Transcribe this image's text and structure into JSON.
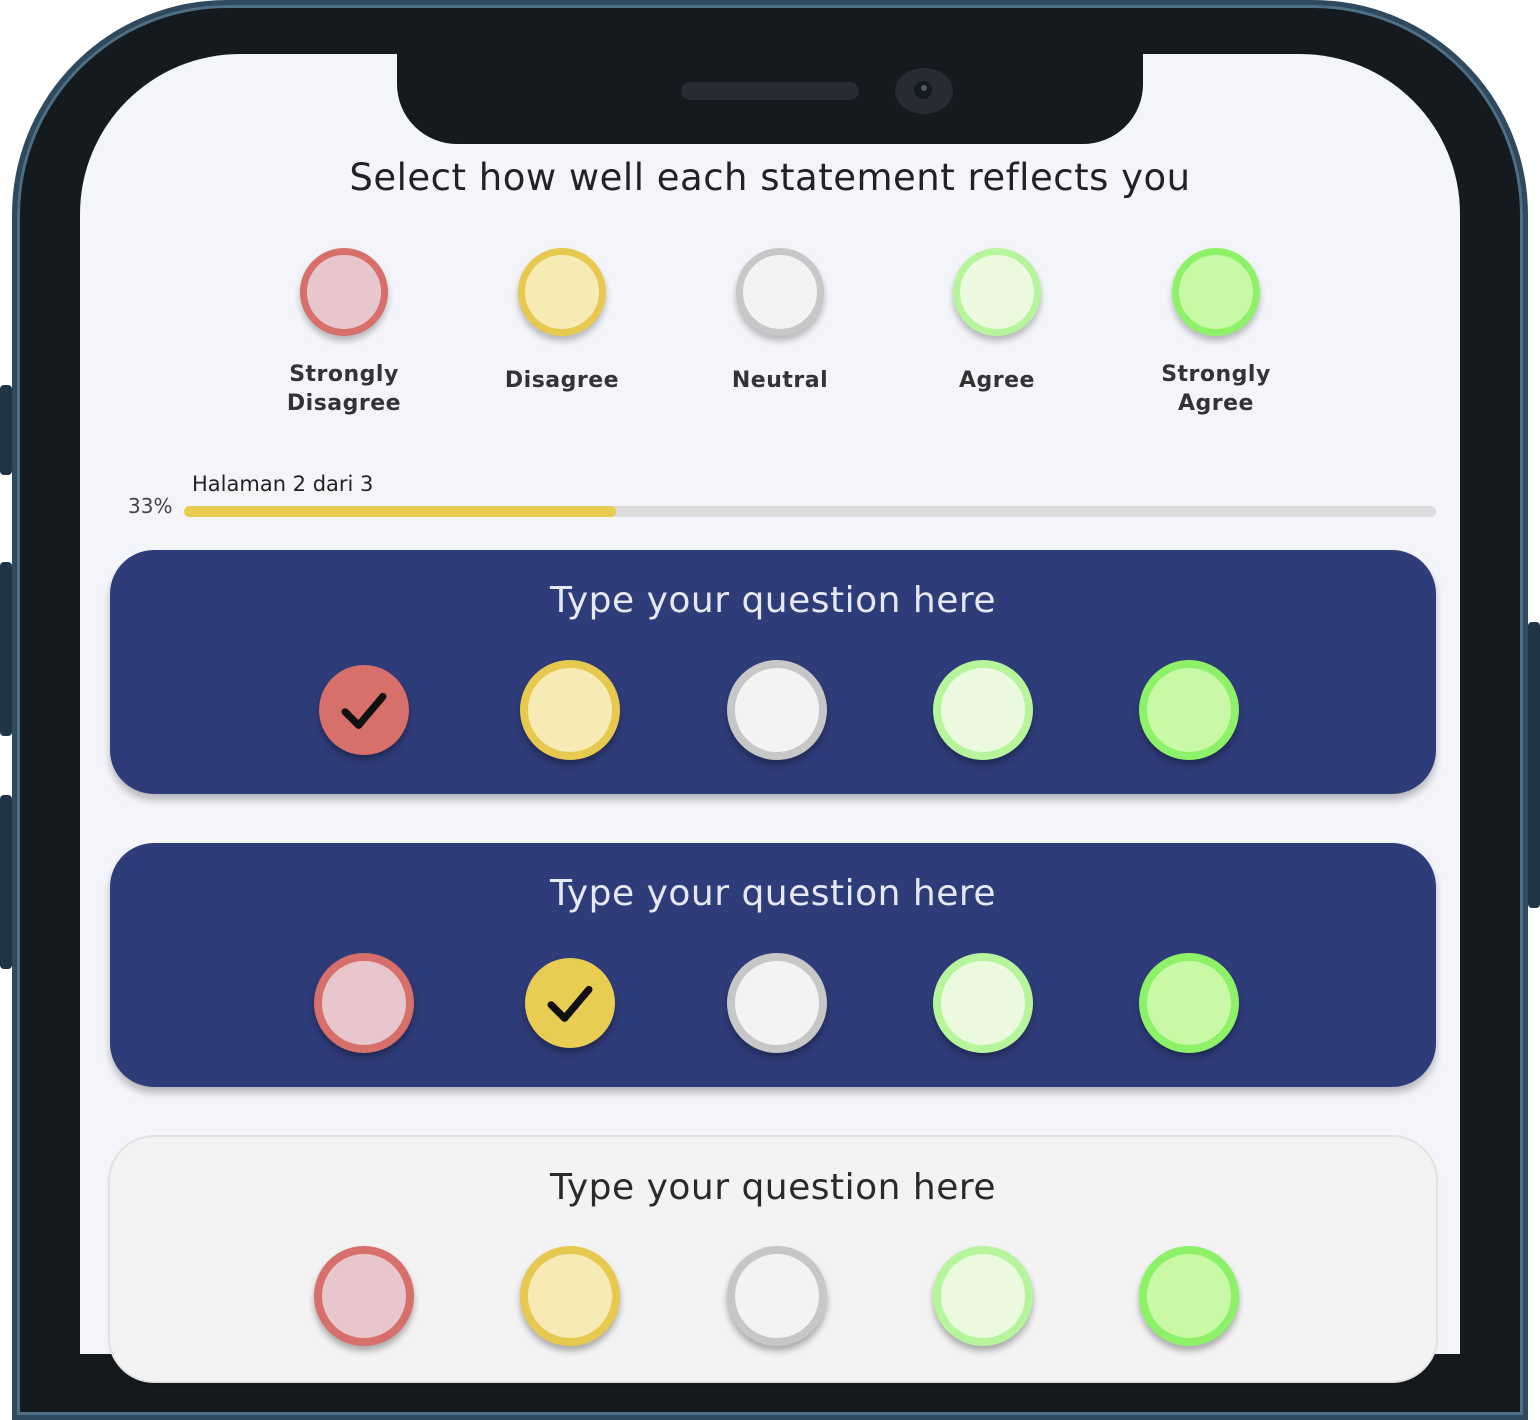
{
  "header": {
    "title": "Select how well each statement reflects you"
  },
  "scale": [
    {
      "label": "Strongly\nDisagree",
      "fill": "#e8c6cd",
      "border": "#d76f6a",
      "selected_fill": "#d76f6a"
    },
    {
      "label": "Disagree",
      "fill": "#f6eab5",
      "border": "#e8c94f",
      "selected_fill": "#e8cd52"
    },
    {
      "label": "Neutral",
      "fill": "#f3f3f3",
      "border": "#c7c7c7",
      "selected_fill": "#c7c7c7"
    },
    {
      "label": "Agree",
      "fill": "#ebfadf",
      "border": "#b6f59b",
      "selected_fill": "#b6f59b"
    },
    {
      "label": "Strongly\nAgree",
      "fill": "#c9f9a6",
      "border": "#8ef269",
      "selected_fill": "#8ef269"
    }
  ],
  "progress": {
    "page_text": "Halaman 2 dari 3",
    "percent_text": "33%",
    "fill_fraction": 0.345,
    "color": "#e8cd52"
  },
  "questions": [
    {
      "text": "Type your question here",
      "selected": 0,
      "active": true
    },
    {
      "text": "Type your question here",
      "selected": 1,
      "active": true
    },
    {
      "text": "Type your question here",
      "selected": null,
      "active": false
    }
  ],
  "colors": {
    "card_active": "#2f3c7a",
    "screen": "#f4f5fa",
    "frame": "#141a1d"
  }
}
